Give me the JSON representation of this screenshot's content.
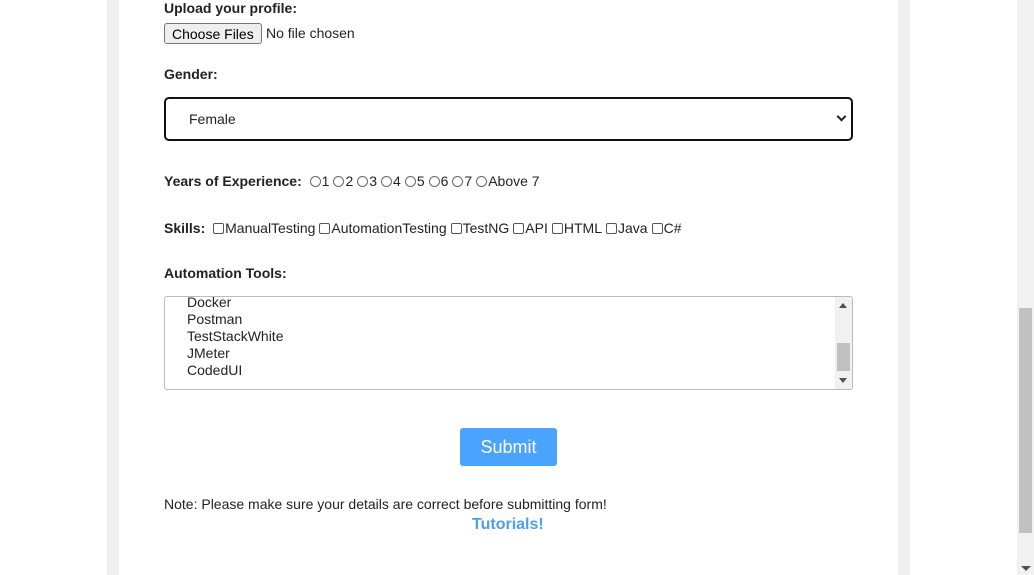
{
  "upload": {
    "label": "Upload your profile:",
    "button": "Choose Files",
    "status": "No file chosen"
  },
  "gender": {
    "label": "Gender:",
    "selected": "Female"
  },
  "experience": {
    "label": "Years of Experience:",
    "options": [
      "1",
      "2",
      "3",
      "4",
      "5",
      "6",
      "7",
      "Above 7"
    ]
  },
  "skills": {
    "label": "Skills:",
    "options": [
      "ManualTesting",
      "AutomationTesting",
      "TestNG",
      "API",
      "HTML",
      "Java",
      "C#"
    ]
  },
  "tools": {
    "label": "Automation Tools:",
    "visible_options": [
      "Docker",
      "Postman",
      "TestStackWhite",
      "JMeter",
      "CodedUI"
    ]
  },
  "submit_label": "Submit",
  "note": "Note: Please make sure your details are correct before submitting form!",
  "tutorials_link": "Tutorials!",
  "page_scroll_fraction": 0.56,
  "colors": {
    "accent": "#4aa3ff",
    "link": "#4a9ff5"
  }
}
